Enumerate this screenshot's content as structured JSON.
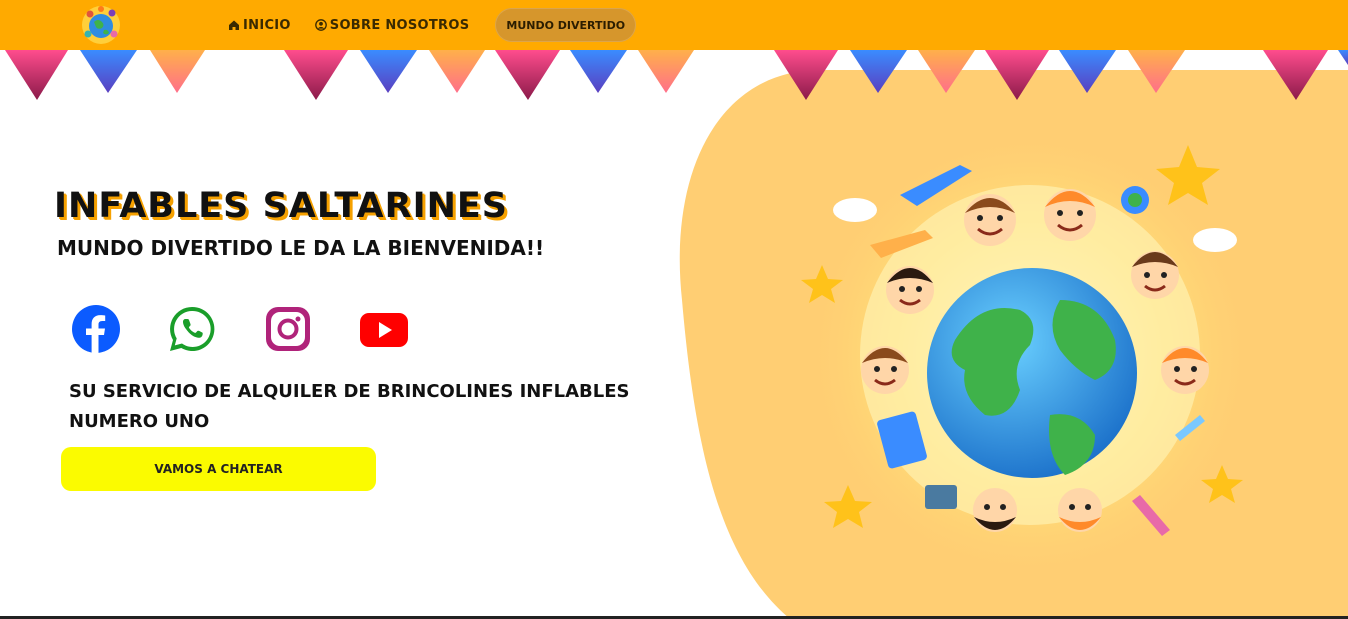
{
  "header": {
    "logo_icon": "globe-kids-logo-icon",
    "nav": [
      {
        "label": "INICIO",
        "icon": "home-icon"
      },
      {
        "label": "SOBRE NOSOTROS",
        "icon": "user-circle-icon"
      }
    ],
    "pill_label": "MUNDO DIVERTIDO"
  },
  "hero": {
    "title": "INFABLES  SALTARINES",
    "subtitle": "MUNDO DIVERTIDO LE DA LA BIENVENIDA!!",
    "socials": [
      {
        "icon": "facebook-icon",
        "color": "#0b5bff"
      },
      {
        "icon": "whatsapp-icon",
        "color": "#1a9e2a"
      },
      {
        "icon": "instagram-icon",
        "color": "#b0237a"
      },
      {
        "icon": "youtube-icon",
        "color": "#ff0000"
      }
    ],
    "tagline": "SU SERVICIO DE ALQUILER DE BRINCOLINES INFLABLES NUMERO UNO",
    "cta_label": "VAMOS A CHATEAR",
    "illustration": "kids-around-globe-illustration"
  },
  "colors": {
    "header_bg": "#ffaa00",
    "blob": "#ffce73",
    "cta_bg": "#fbfb00",
    "bunting": [
      "#c2286a",
      "#3f6be0",
      "#ff8e5a"
    ]
  }
}
